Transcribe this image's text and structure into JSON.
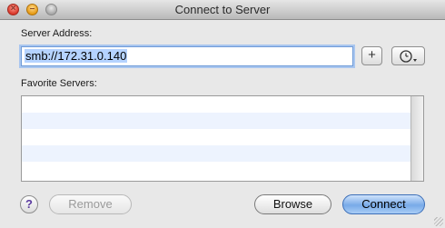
{
  "window": {
    "title": "Connect to Server"
  },
  "server_address": {
    "label": "Server Address:",
    "value": "smb://172.31.0.140",
    "add_label": "+",
    "recent_icon": "clock-dropdown-icon"
  },
  "favorites": {
    "label": "Favorite Servers:",
    "items": []
  },
  "buttons": {
    "help_label": "?",
    "remove_label": "Remove",
    "browse_label": "Browse",
    "connect_label": "Connect"
  },
  "colors": {
    "selection": "#b5d3ff",
    "focus_ring": "#a9c6ef",
    "default_button": "#78aae8",
    "list_alt_row": "#edf3fe"
  }
}
